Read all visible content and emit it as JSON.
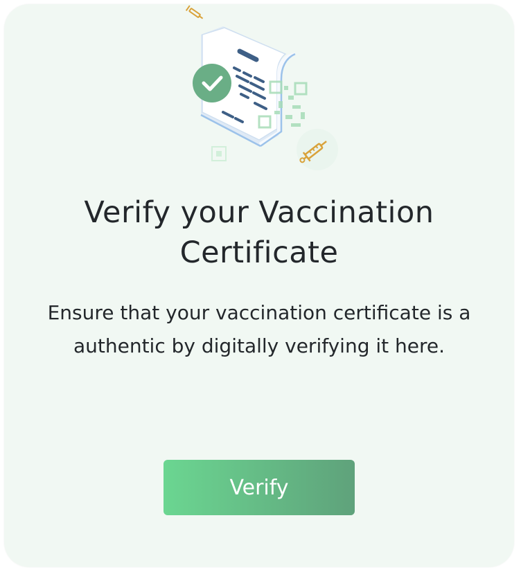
{
  "card": {
    "title": "Verify your Vaccination Certificate",
    "description": "Ensure that your vaccination certificate is a authentic by digitally verifying it here.",
    "verify_label": "Verify"
  },
  "colors": {
    "card_background": "#f1f8f3",
    "text": "#23272b",
    "button_gradient_start": "#6bd691",
    "button_gradient_end": "#5fa27b",
    "check_badge": "#6aae86",
    "document_lines": "#3e5f86",
    "qr_code": "#a7dcb8",
    "syringe": "#d9a23a"
  },
  "illustration": {
    "icons": [
      "certificate-document-icon",
      "check-badge-icon",
      "qr-code-icon",
      "syringe-icon"
    ]
  }
}
